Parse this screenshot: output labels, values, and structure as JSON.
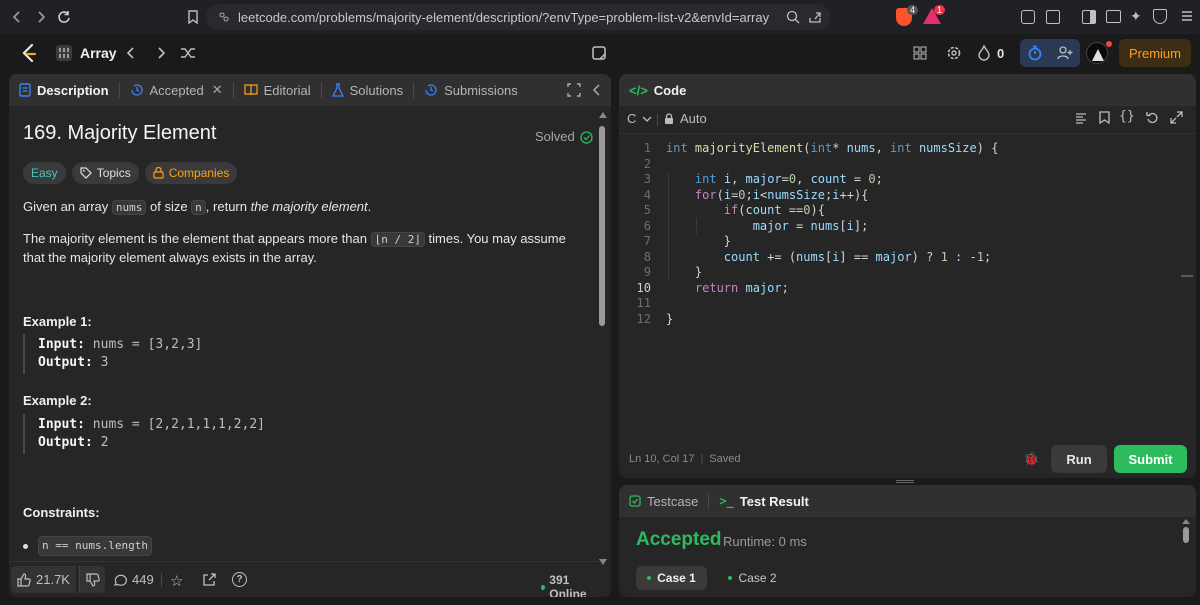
{
  "browser": {
    "url": "leetcode.com/problems/majority-element/description/?envType=problem-list-v2&envId=array",
    "shield_badge": "4",
    "alert_badge": "1"
  },
  "nav": {
    "problem_list": "Array",
    "streak_count": "0",
    "premium_label": "Premium"
  },
  "tabs": {
    "description": "Description",
    "accepted": "Accepted",
    "editorial": "Editorial",
    "solutions": "Solutions",
    "submissions": "Submissions"
  },
  "problem": {
    "title": "169. Majority Element",
    "solved_label": "Solved",
    "difficulty": "Easy",
    "topics": "Topics",
    "companies": "Companies",
    "p1_a": "Given an array ",
    "p1_code1": "nums",
    "p1_b": " of size ",
    "p1_code2": "n",
    "p1_c": ", return ",
    "p1_em": "the majority element",
    "p1_d": ".",
    "p2_a": "The majority element is the element that appears more than ",
    "p2_code": "⌊n / 2⌋",
    "p2_b": " times. You may assume that the majority element always exists in the array.",
    "example1_title": "Example 1:",
    "example1_input_label": "Input:",
    "example1_input": "nums = [3,2,3]",
    "example1_output_label": "Output:",
    "example1_output": "3",
    "example2_title": "Example 2:",
    "example2_input_label": "Input:",
    "example2_input": "nums = [2,2,1,1,1,2,2]",
    "example2_output_label": "Output:",
    "example2_output": "2",
    "constraints_title": "Constraints:",
    "constraint1": "n == nums.length"
  },
  "footer": {
    "likes": "21.7K",
    "comments": "449",
    "online": "391 Online"
  },
  "code_panel": {
    "title": "Code",
    "language": "C",
    "mode": "Auto",
    "status_pos": "Ln 10, Col 17",
    "status_saved": "Saved",
    "run_label": "Run",
    "submit_label": "Submit"
  },
  "code_lines": [
    {
      "n": "1"
    },
    {
      "n": "2"
    },
    {
      "n": "3"
    },
    {
      "n": "4"
    },
    {
      "n": "5"
    },
    {
      "n": "6"
    },
    {
      "n": "7"
    },
    {
      "n": "8"
    },
    {
      "n": "9"
    },
    {
      "n": "10"
    },
    {
      "n": "11"
    },
    {
      "n": "12"
    }
  ],
  "code_text": [
    "int majorityElement(int* nums, int numsSize) {",
    "",
    "    int i, major=0, count = 0;",
    "    for(i=0;i<numsSize;i++){",
    "        if(count ==0){",
    "            major = nums[i];",
    "        }",
    "        count += (nums[i] == major) ? 1 : -1;",
    "    }",
    "    return major;",
    "",
    "}"
  ],
  "result_panel": {
    "testcase_tab": "Testcase",
    "result_tab": "Test Result",
    "status": "Accepted",
    "runtime": "Runtime: 0 ms",
    "case1": "Case 1",
    "case2": "Case 2"
  },
  "colors": {
    "accent_green": "#2cbb5d",
    "easy_teal": "#46c6c2",
    "premium_orange": "#ffa116",
    "blue_icon": "#3b82f6"
  }
}
